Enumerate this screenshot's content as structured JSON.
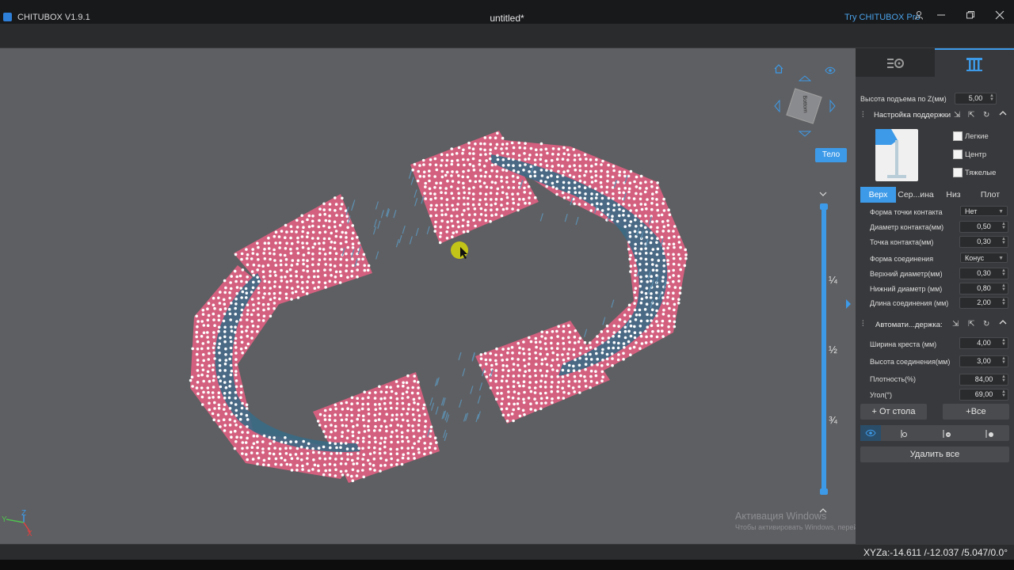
{
  "titlebar": {
    "app_name": "CHITUBOX V1.9.1",
    "document": "untitled*",
    "pro_link": "Try CHITUBOX Pro"
  },
  "viewport": {
    "body_button": "Тело",
    "view_cube_label": "Bottom",
    "slider_ticks": [
      "¼",
      "½",
      "¾"
    ],
    "watermark_title": "Активация Windows",
    "watermark_text": "Чтобы активировать Windows, перейдите в раздел \"Параметры\"."
  },
  "statusbar": {
    "coords": "XYZa:-14.611 /-12.037 /5.047/0.0°"
  },
  "panel": {
    "lift_label": "Высота подъема по Z(мм)",
    "lift_value": "5,00",
    "support_settings_title": "Настройка поддержки",
    "presets": [
      "Легкие",
      "Центр",
      "Тяжелые"
    ],
    "subtabs": [
      "Верх",
      "Сер...ина",
      "Низ",
      "Плот"
    ],
    "top_params": [
      {
        "label": "Форма точки контакта",
        "value": "Нет",
        "kind": "select"
      },
      {
        "label": "Диаметр контакта(мм)",
        "value": "0,50",
        "kind": "field"
      },
      {
        "label": "Точка контакта(мм)",
        "value": "0,30",
        "kind": "field"
      },
      {
        "label": "Форма соединения",
        "value": "Конус",
        "kind": "select"
      },
      {
        "label": "Верхний диаметр(мм)",
        "value": "0,30",
        "kind": "field"
      },
      {
        "label": "Нижний диаметр (мм)",
        "value": "0,80",
        "kind": "field"
      },
      {
        "label": "Длина соединения (мм)",
        "value": "2,00",
        "kind": "field"
      }
    ],
    "auto_title": "Автомати...держка:",
    "auto_params": [
      {
        "label": "Ширина креста (мм)",
        "value": "4,00"
      },
      {
        "label": "Высота соединения(мм)",
        "value": "3,00"
      },
      {
        "label": "Плотность(%)",
        "value": "84,00"
      },
      {
        "label": "Угол(°)",
        "value": "69,00"
      }
    ],
    "from_table_button": "+ От стола",
    "all_button": "+Все",
    "delete_all_button": "Удалить все"
  },
  "axes": {
    "x": "X",
    "y": "Y",
    "z": "Z"
  },
  "colors": {
    "accent": "#3d9ae8",
    "model": "#d4607f",
    "support_dots": "#ffffff",
    "support_body": "#3a6a85"
  }
}
